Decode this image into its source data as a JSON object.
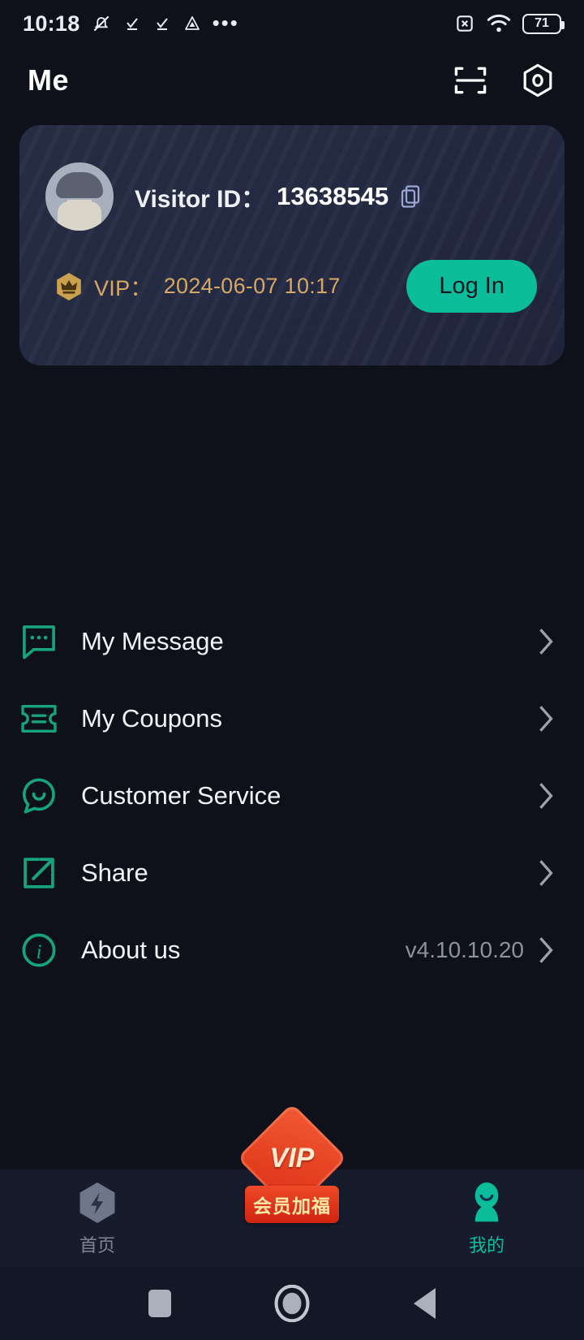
{
  "status_bar": {
    "time": "10:18",
    "battery_level": "71",
    "icons_left": [
      "mute-bell-icon",
      "check-underline-icon",
      "check-underline-icon",
      "triangle-drop-icon",
      "more-dots-icon"
    ],
    "icons_right": [
      "sim-x-icon",
      "wifi-icon",
      "battery-icon"
    ]
  },
  "header": {
    "title": "Me",
    "scan_icon": "scan-qr-icon",
    "settings_icon": "hexagon-settings-icon"
  },
  "profile_card": {
    "avatar_icon": "user-avatar",
    "id_label": "Visitor ID：",
    "id_value": "13638545",
    "copy_icon": "copy-icon",
    "vip_icon": "crown-badge-icon",
    "vip_label": "VIP：",
    "vip_expiry": "2024-06-07 10:17",
    "login_label": "Log In",
    "accent_color": "#0bbd9a",
    "vip_text_color": "#d6a765"
  },
  "menu": {
    "items": [
      {
        "label": "My Message",
        "icon": "message-bubble-icon",
        "value": ""
      },
      {
        "label": "My Coupons",
        "icon": "coupon-ticket-icon",
        "value": ""
      },
      {
        "label": "Customer Service",
        "icon": "support-smile-icon",
        "value": ""
      },
      {
        "label": "Share",
        "icon": "share-external-icon",
        "value": ""
      },
      {
        "label": "About us",
        "icon": "info-circle-icon",
        "value": "v4.10.10.20"
      }
    ]
  },
  "tab_bar": {
    "tabs": [
      {
        "label": "首页",
        "icon": "hexagon-bolt-icon",
        "active": false
      },
      {
        "label": "会员加福",
        "icon": "vip-diamond-badge",
        "badge_text": "VIP",
        "active": false
      },
      {
        "label": "我的",
        "icon": "person-icon",
        "active": true
      }
    ],
    "active_color": "#0bbd9a",
    "inactive_color": "#7e8694"
  },
  "nav_bar": {
    "recent_icon": "square-recents-icon",
    "home_icon": "circle-home-icon",
    "back_icon": "triangle-back-icon"
  }
}
